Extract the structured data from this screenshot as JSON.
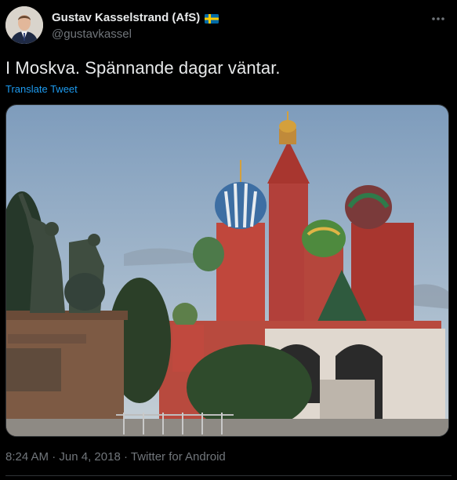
{
  "author": {
    "display_name": "Gustav Kasselstrand (AfS)",
    "flag_icon": "sweden-flag-icon",
    "handle": "@gustavkassel"
  },
  "tweet": {
    "text": "I Moskva. Spännande dagar väntar.",
    "translate_label": "Translate Tweet"
  },
  "meta": {
    "time": "8:24 AM",
    "date": "Jun 4, 2018",
    "source": "Twitter for Android",
    "separator": " · "
  },
  "colors": {
    "background": "#000000",
    "text": "#e7e9ea",
    "muted": "#71767b",
    "link": "#1d9bf0",
    "border": "#2f3336"
  }
}
